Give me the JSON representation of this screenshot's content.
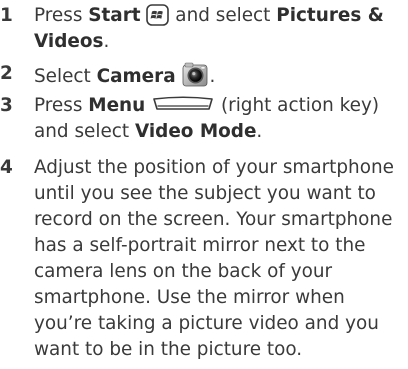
{
  "steps": [
    {
      "number": "1",
      "press": "Press",
      "start": "Start",
      "and_select": "and select",
      "pictures_videos_1": "Pictures &",
      "pictures_videos_2": "Videos",
      "period": "."
    },
    {
      "number": "2",
      "select": "Select",
      "camera": "Camera",
      "period": "."
    },
    {
      "number": "3",
      "press": "Press",
      "menu": "Menu",
      "right_action_key": "(right action key)",
      "and_select": "and select",
      "video_mode": "Video Mode",
      "period": "."
    },
    {
      "number": "4",
      "lines": [
        "Adjust the position of your smartphone",
        "until you see the subject you want to",
        "record on the screen. Your smartphone",
        "has a self-portrait mirror next to the",
        "camera lens on the back of your",
        "smartphone. Use the mirror when",
        "you’re taking a picture video and you",
        "want to be in the picture too."
      ]
    }
  ],
  "icons": {
    "start": "windows-start-key-icon",
    "camera": "camera-icon",
    "menu": "right-action-key-icon"
  },
  "colors": {
    "text": "#3a3a3a",
    "bold_text": "#2f2f2f"
  }
}
